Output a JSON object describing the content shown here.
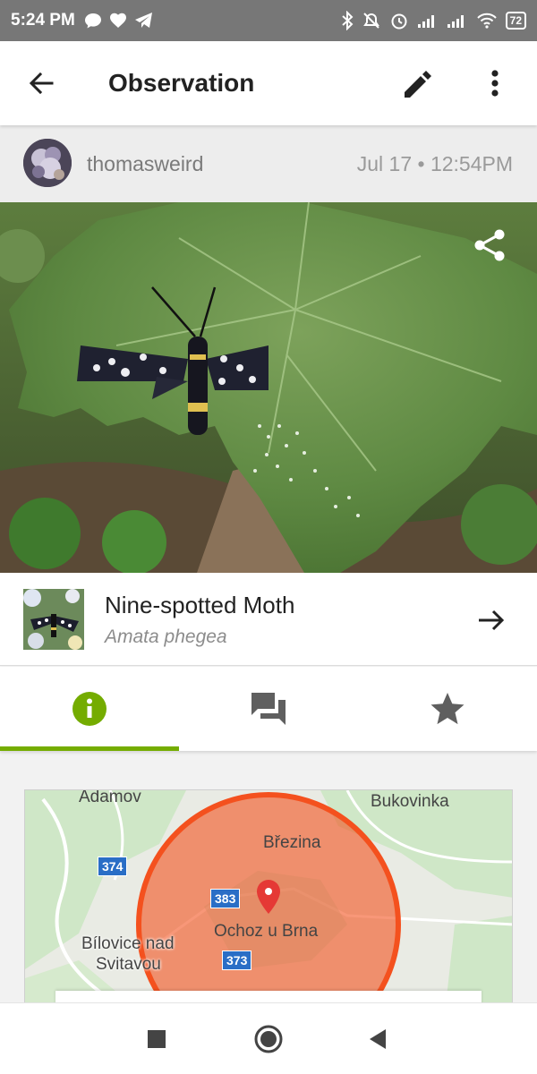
{
  "status_bar": {
    "time": "5:24 PM",
    "battery": "72",
    "left_icons": [
      "chat-bubble-icon",
      "heart-icon",
      "telegram-icon"
    ],
    "right_icons": [
      "bluetooth-icon",
      "alarm-off-icon",
      "alarm-icon",
      "signal-icon",
      "signal-icon",
      "wifi-icon",
      "battery-icon"
    ]
  },
  "app_bar": {
    "title": "Observation",
    "back_icon": "arrow-back-icon",
    "edit_icon": "pencil-icon",
    "more_icon": "more-vert-icon"
  },
  "observation": {
    "username": "thomasweird",
    "date": "Jul 17 • 12:54PM",
    "share_icon": "share-icon"
  },
  "taxon": {
    "common_name": "Nine-spotted Moth",
    "scientific_name": "Amata phegea"
  },
  "tabs": [
    {
      "name": "info",
      "icon": "info-icon",
      "active": true
    },
    {
      "name": "activity",
      "icon": "forum-icon",
      "active": false
    },
    {
      "name": "favorites",
      "icon": "star-icon",
      "active": false
    }
  ],
  "map": {
    "labels": {
      "adamov": "Adamov",
      "bukovinka": "Bukovinka",
      "brezina": "Březina",
      "ochoz": "Ochoz u Brna",
      "bilovice_1": "Bílovice nad",
      "bilovice_2": "Svitavou"
    },
    "roads": {
      "r374": "374",
      "r383": "383",
      "r373": "373"
    },
    "accuracy_circle_color": "#f4511e",
    "marker_color": "#e53935"
  },
  "colors": {
    "accent": "#74ac00",
    "status_bar": "#777777"
  },
  "nav_bar": {
    "buttons": [
      "recents-square-icon",
      "home-circle-icon",
      "back-triangle-icon"
    ]
  }
}
